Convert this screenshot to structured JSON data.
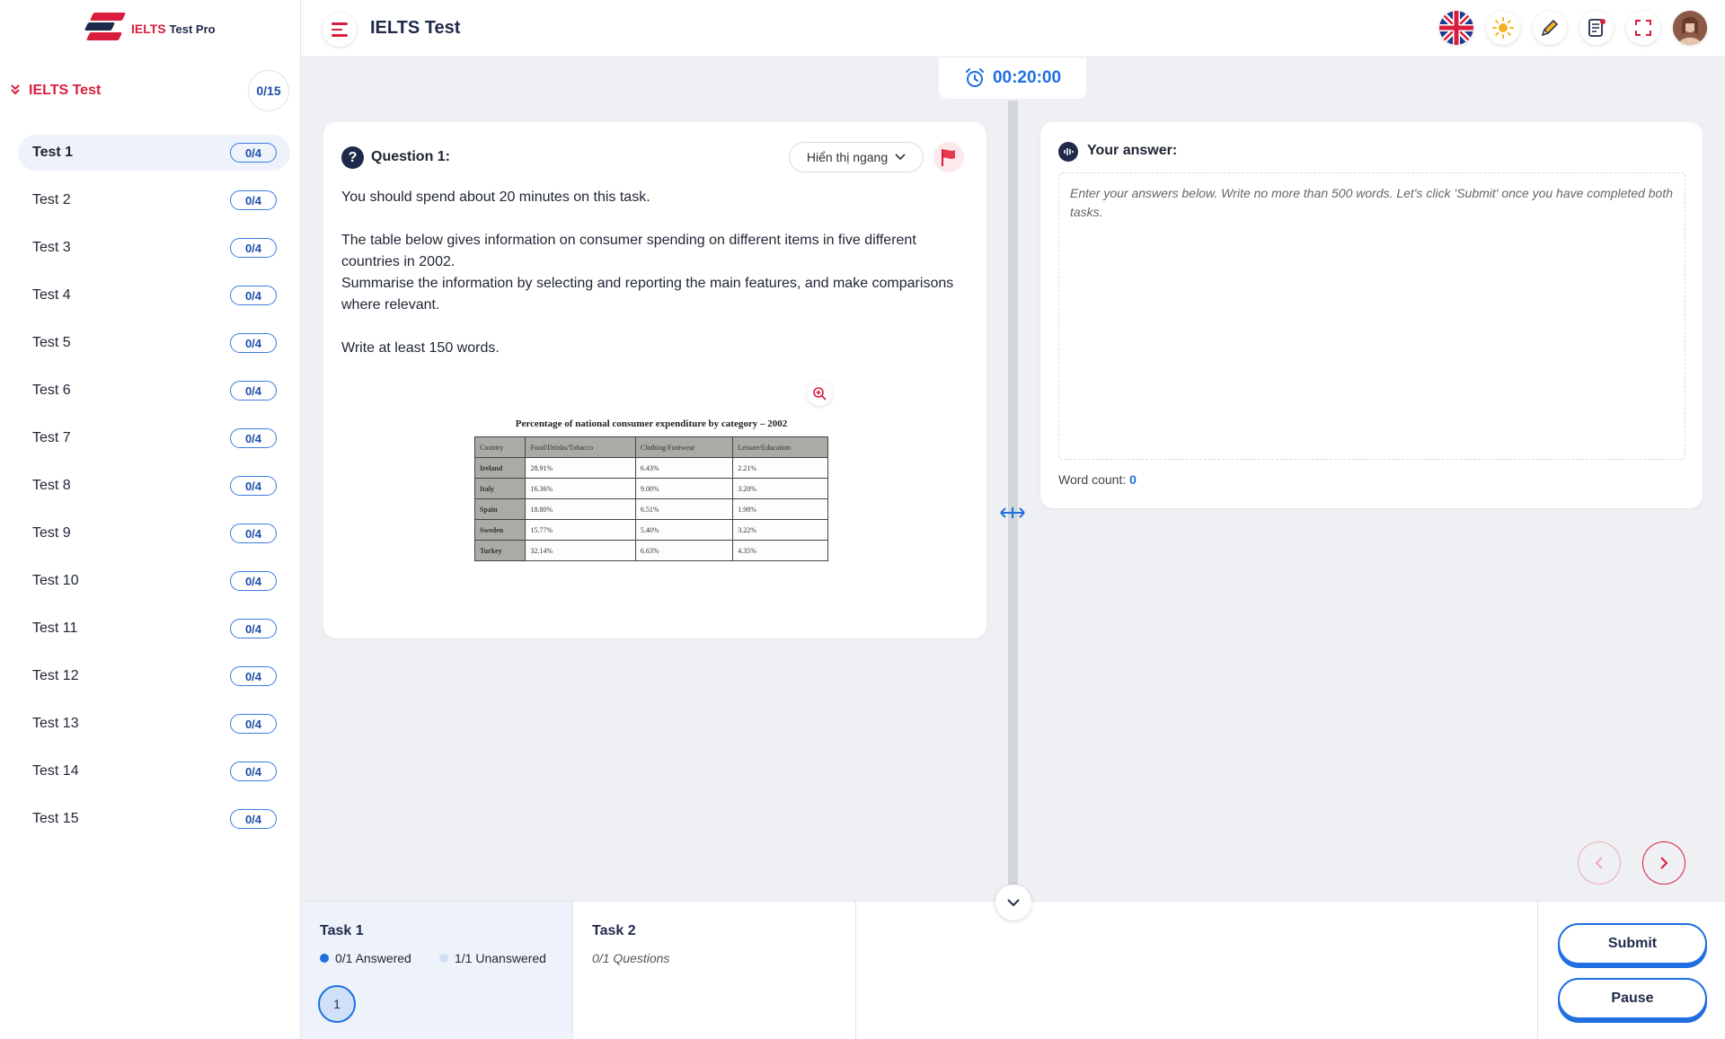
{
  "app": {
    "brand_primary": "IELTS",
    "brand_secondary": "Test Pro",
    "header_title": "IELTS Test"
  },
  "sidebar": {
    "title": "IELTS Test",
    "progress": "0/15",
    "tests": [
      {
        "label": "Test 1",
        "score": "0/4",
        "active": true
      },
      {
        "label": "Test 2",
        "score": "0/4"
      },
      {
        "label": "Test 3",
        "score": "0/4"
      },
      {
        "label": "Test 4",
        "score": "0/4"
      },
      {
        "label": "Test 5",
        "score": "0/4"
      },
      {
        "label": "Test 6",
        "score": "0/4"
      },
      {
        "label": "Test 7",
        "score": "0/4"
      },
      {
        "label": "Test 8",
        "score": "0/4"
      },
      {
        "label": "Test 9",
        "score": "0/4"
      },
      {
        "label": "Test 10",
        "score": "0/4"
      },
      {
        "label": "Test 11",
        "score": "0/4"
      },
      {
        "label": "Test 12",
        "score": "0/4"
      },
      {
        "label": "Test 13",
        "score": "0/4"
      },
      {
        "label": "Test 14",
        "score": "0/4"
      },
      {
        "label": "Test 15",
        "score": "0/4"
      }
    ]
  },
  "header_icons": [
    "uk-flag-icon",
    "sun-icon",
    "pencil-icon",
    "notes-icon",
    "fullscreen-icon",
    "user-avatar"
  ],
  "timer": "00:20:00",
  "question": {
    "title": "Question 1:",
    "display_mode": "Hiển thị ngang",
    "paragraphs": [
      "You should spend about 20 minutes on this task.",
      "",
      "The table below gives information on consumer spending on different items in five different countries in 2002.",
      "Summarise the information by selecting and reporting the main features, and make comparisons where relevant.",
      "",
      "Write at least 150 words."
    ],
    "image": {
      "title": "Percentage of national consumer expenditure by category – 2002",
      "headers": [
        "Country",
        "Food/Drinks/Tobacco",
        "Clothing/Footwear",
        "Leisure/Education"
      ],
      "rows": [
        [
          "Ireland",
          "28.91%",
          "6.43%",
          "2.21%"
        ],
        [
          "Italy",
          "16.36%",
          "9.00%",
          "3.20%"
        ],
        [
          "Spain",
          "18.80%",
          "6.51%",
          "1.98%"
        ],
        [
          "Sweden",
          "15.77%",
          "5.40%",
          "3.22%"
        ],
        [
          "Turkey",
          "32.14%",
          "6.63%",
          "4.35%"
        ]
      ]
    }
  },
  "answer": {
    "title": "Your answer:",
    "placeholder": "Enter your answers below. Write no more than 500 words. Let's click 'Submit' once you have completed both tasks.",
    "word_count_label": "Word count:",
    "word_count": "0"
  },
  "tasks": [
    {
      "label": "Task 1",
      "answered": "0/1 Answered",
      "unanswered": "1/1 Unanswered",
      "questions": [
        "1"
      ]
    },
    {
      "label": "Task 2",
      "subtitle": "0/1 Questions"
    }
  ],
  "actions": {
    "submit": "Submit",
    "pause": "Pause"
  },
  "colors": {
    "brand_red": "#d81e3c",
    "accent_blue": "#1f6fe0",
    "navy": "#1f2a4a"
  }
}
